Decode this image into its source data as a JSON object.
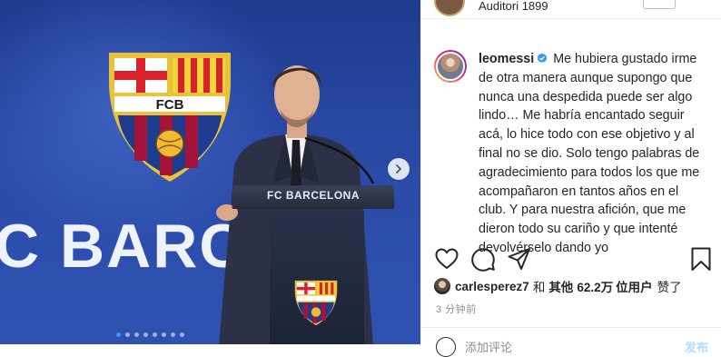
{
  "photo": {
    "wall_text": "C BARCE",
    "podium_label": "FC BARCELONA",
    "crest_letters": "FCB",
    "carousel_dots": 8,
    "carousel_active_index": 0,
    "next_icon": "chevron-right-icon"
  },
  "header": {
    "location": "Auditori 1899"
  },
  "post": {
    "username": "leomessi",
    "verified": true,
    "caption": "Me hubiera gustado irme de otra manera aunque supongo que nunca una despedida puede ser algo lindo… Me habría encantado seguir acá, lo hice todo con ese objetivo y al final no se dio. Solo tengo palabras de agradecimiento para todos los que me acompañaron en tantos años en el club. Y para nuestra afición, que me dieron todo su cariño y que intenté devolvérselo dando yo"
  },
  "actions": {
    "like_icon": "heart-icon",
    "comment_icon": "comment-icon",
    "share_icon": "send-icon",
    "save_icon": "bookmark-icon"
  },
  "likes": {
    "user": "carlesperez7",
    "and": "和",
    "others_label": "其他",
    "count": "62.2万",
    "users_suffix": "位用户",
    "liked_label": "赞了"
  },
  "timestamp": "3 分钟前",
  "comment_box": {
    "placeholder": "添加评论",
    "post_label": "发布"
  },
  "colors": {
    "accent": "#3897f0",
    "text": "#262626",
    "muted": "#8e8e8e",
    "verified": "#3897f0"
  }
}
